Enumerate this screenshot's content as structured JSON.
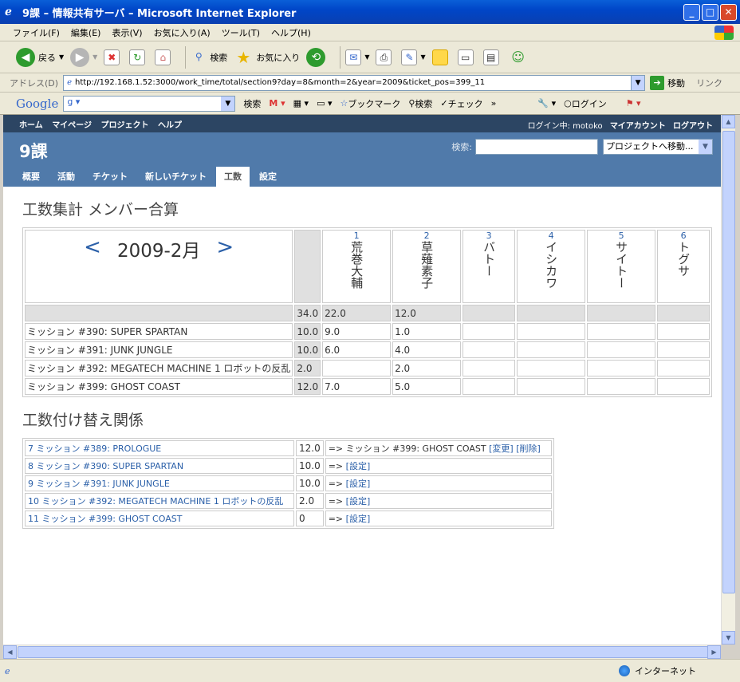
{
  "window": {
    "title": "9課 – 情報共有サーバ – Microsoft Internet Explorer",
    "minimize": "_",
    "maximize": "□",
    "close": "✕"
  },
  "menubar": [
    "ファイル(F)",
    "編集(E)",
    "表示(V)",
    "お気に入り(A)",
    "ツール(T)",
    "ヘルプ(H)"
  ],
  "toolbar": {
    "back": "戻る",
    "search": "検索",
    "favorites": "お気に入り"
  },
  "address": {
    "label": "アドレス(D)",
    "url": "http://192.168.1.52:3000/work_time/total/section9?day=8&month=2&year=2009&ticket_pos=399_11",
    "go": "移動",
    "links": "リンク"
  },
  "googlebar": {
    "logo": "Google",
    "search": "検索",
    "bookmarks": "ブックマーク",
    "search2": "検索",
    "check": "チェック",
    "login": "ログイン"
  },
  "topmenu": {
    "items": [
      "ホーム",
      "マイページ",
      "プロジェクト",
      "ヘルプ"
    ],
    "logged_in": "ログイン中: motoko",
    "my_account": "マイアカウント",
    "logout": "ログアウト"
  },
  "header": {
    "project_title": "9課",
    "search_label": "検索:",
    "jump": "プロジェクトへ移動..."
  },
  "tabs": [
    "概要",
    "活動",
    "チケット",
    "新しいチケット",
    "工数",
    "設定"
  ],
  "selected_tab": "工数",
  "summary": {
    "heading": "工数集計 メンバー合算",
    "prev": "<",
    "month": "2009-2月",
    "next": ">",
    "members": [
      {
        "num": "1",
        "name": "荒巻大輔"
      },
      {
        "num": "2",
        "name": "草薙素子"
      },
      {
        "num": "3",
        "name": "バトー"
      },
      {
        "num": "4",
        "name": "イシカワ"
      },
      {
        "num": "5",
        "name": "サイトー"
      },
      {
        "num": "6",
        "name": "トグサ"
      }
    ],
    "total_row": {
      "total": "34.0",
      "values": [
        "22.0",
        "12.0",
        "",
        "",
        "",
        ""
      ]
    },
    "rows": [
      {
        "ticket": "ミッション #390: SUPER SPARTAN",
        "total": "10.0",
        "values": [
          "9.0",
          "1.0",
          "",
          "",
          "",
          ""
        ]
      },
      {
        "ticket": "ミッション #391: JUNK JUNGLE",
        "total": "10.0",
        "values": [
          "6.0",
          "4.0",
          "",
          "",
          "",
          ""
        ]
      },
      {
        "ticket": "ミッション #392: MEGATECH MACHINE 1 ロボットの反乱",
        "total": "2.0",
        "values": [
          "",
          "2.0",
          "",
          "",
          "",
          ""
        ]
      },
      {
        "ticket": "ミッション #399: GHOST COAST",
        "total": "12.0",
        "values": [
          "7.0",
          "5.0",
          "",
          "",
          "",
          ""
        ]
      }
    ]
  },
  "relations": {
    "heading": "工数付け替え関係",
    "rows": [
      {
        "ticket": "7 ミッション #389: PROLOGUE",
        "value": "12.0",
        "arrow": "=> ミッション #399: GHOST COAST",
        "links": [
          "[変更]",
          "[削除]"
        ]
      },
      {
        "ticket": "8 ミッション #390: SUPER SPARTAN",
        "value": "10.0",
        "arrow": "=>",
        "links": [
          "[設定]"
        ]
      },
      {
        "ticket": "9 ミッション #391: JUNK JUNGLE",
        "value": "10.0",
        "arrow": "=>",
        "links": [
          "[設定]"
        ]
      },
      {
        "ticket": "10 ミッション #392: MEGATECH MACHINE 1 ロボットの反乱",
        "value": "2.0",
        "arrow": "=>",
        "links": [
          "[設定]"
        ]
      },
      {
        "ticket": "11 ミッション #399: GHOST COAST",
        "value": "0",
        "arrow": "=>",
        "links": [
          "[設定]"
        ]
      }
    ]
  },
  "status": {
    "zone": "インターネット"
  }
}
